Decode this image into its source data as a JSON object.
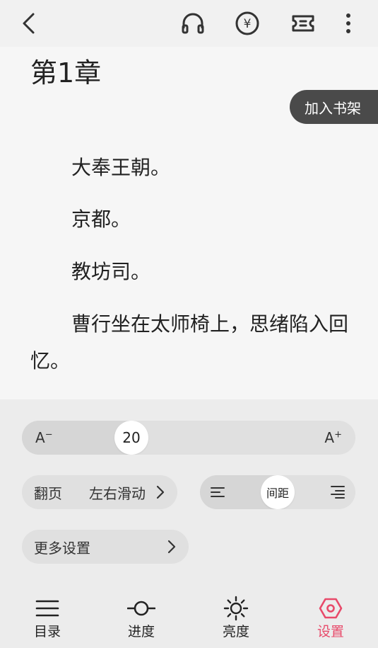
{
  "topbar": {
    "icons": [
      "back-icon",
      "headphones-icon",
      "yuan-coin-icon",
      "ticket-icon",
      "more-vertical-icon"
    ],
    "coin_symbol": "¥"
  },
  "reader": {
    "chapter_title": "第1章",
    "add_to_shelf": "加入书架",
    "paragraphs": [
      "大奉王朝。",
      "京都。",
      "教坊司。",
      "曹行坐在太师椅上，思绪陷入回忆。"
    ]
  },
  "settings": {
    "font_size": {
      "decrease_label": "A",
      "decrease_mark": "−",
      "increase_label": "A",
      "increase_mark": "+",
      "value": "20",
      "fraction": 0.31
    },
    "page_turn": {
      "label": "翻页",
      "value": "左右滑动"
    },
    "spacing": {
      "label": "间距",
      "fraction": 0.5
    },
    "more_settings": {
      "label": "更多设置"
    }
  },
  "tabs": [
    {
      "label": "目录",
      "icon": "menu-icon"
    },
    {
      "label": "进度",
      "icon": "progress-icon"
    },
    {
      "label": "亮度",
      "icon": "sun-icon"
    },
    {
      "label": "设置",
      "icon": "settings-hex-icon",
      "active": true
    }
  ],
  "colors": {
    "active_tab": "#e84a6a",
    "shelf_button": "#4a4a4a"
  }
}
